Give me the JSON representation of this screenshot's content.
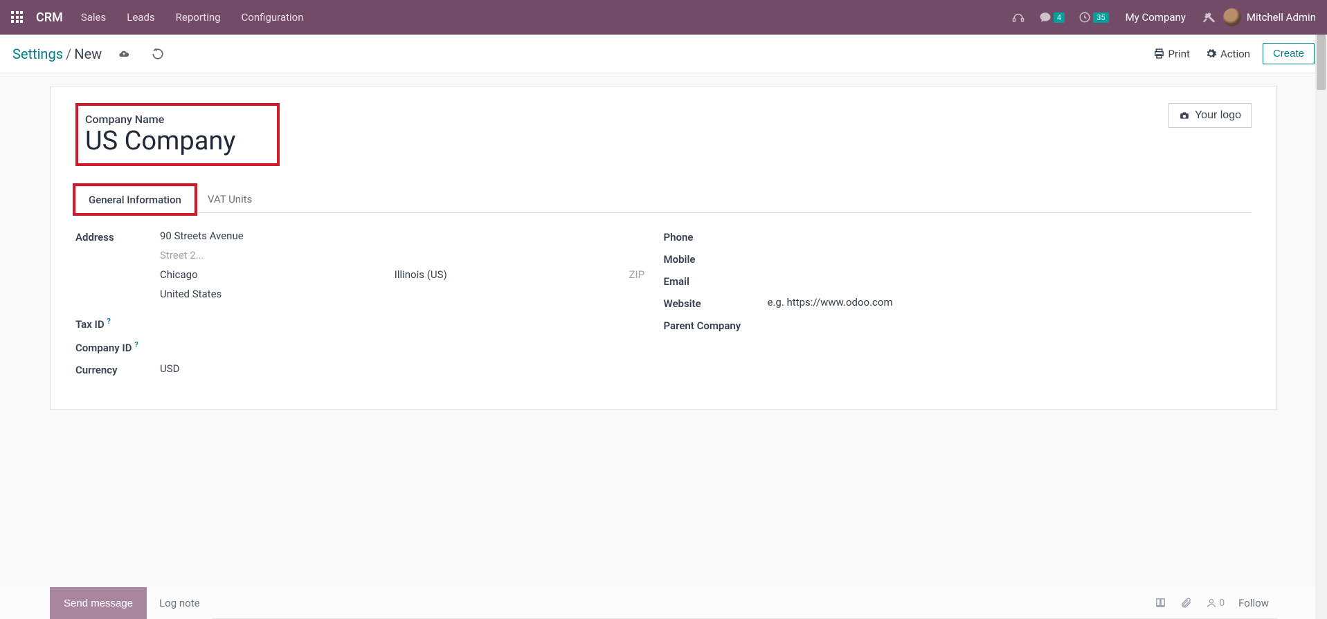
{
  "topnav": {
    "brand": "CRM",
    "menu": [
      "Sales",
      "Leads",
      "Reporting",
      "Configuration"
    ],
    "msg_badge": "4",
    "clock_badge": "35",
    "company": "My Company",
    "user": "Mitchell Admin"
  },
  "actionbar": {
    "crumb_root": "Settings",
    "crumb_current": "New",
    "print": "Print",
    "action": "Action",
    "create": "Create"
  },
  "form": {
    "company_name_label": "Company Name",
    "company_name_value": "US Company",
    "logo_btn": "Your logo",
    "tabs": {
      "general": "General Information",
      "vat": "VAT Units"
    },
    "left": {
      "address_label": "Address",
      "street1": "90 Streets Avenue",
      "street2_ph": "Street 2...",
      "city": "Chicago",
      "state": "Illinois (US)",
      "zip_ph": "ZIP",
      "country": "United States",
      "taxid_label": "Tax ID",
      "companyid_label": "Company ID",
      "currency_label": "Currency",
      "currency_value": "USD"
    },
    "right": {
      "phone": "Phone",
      "mobile": "Mobile",
      "email": "Email",
      "website": "Website",
      "website_ph": "e.g. https://www.odoo.com",
      "parent": "Parent Company"
    }
  },
  "chatter": {
    "send": "Send message",
    "lognote": "Log note",
    "follower_count": "0",
    "follow": "Follow"
  }
}
